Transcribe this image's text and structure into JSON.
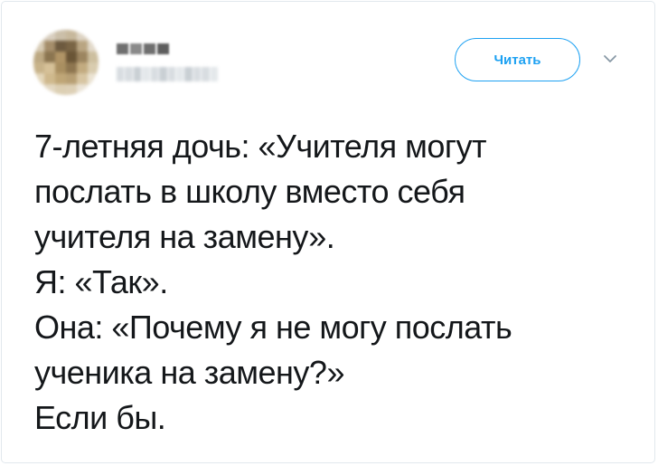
{
  "header": {
    "follow_label": "Читать"
  },
  "icons": {
    "menu": "chevron-down-icon"
  },
  "colors": {
    "accent": "#1da1f2",
    "text": "#14171a",
    "border": "#e1e8ed"
  },
  "tweet": {
    "lines": [
      "7-летняя дочь: «Учителя могут",
      "послать в школу вместо себя",
      "учителя на замену».",
      "Я: «Так».",
      "Она: «Почему я не могу послать",
      "ученика на замену?»",
      "Если бы."
    ]
  }
}
